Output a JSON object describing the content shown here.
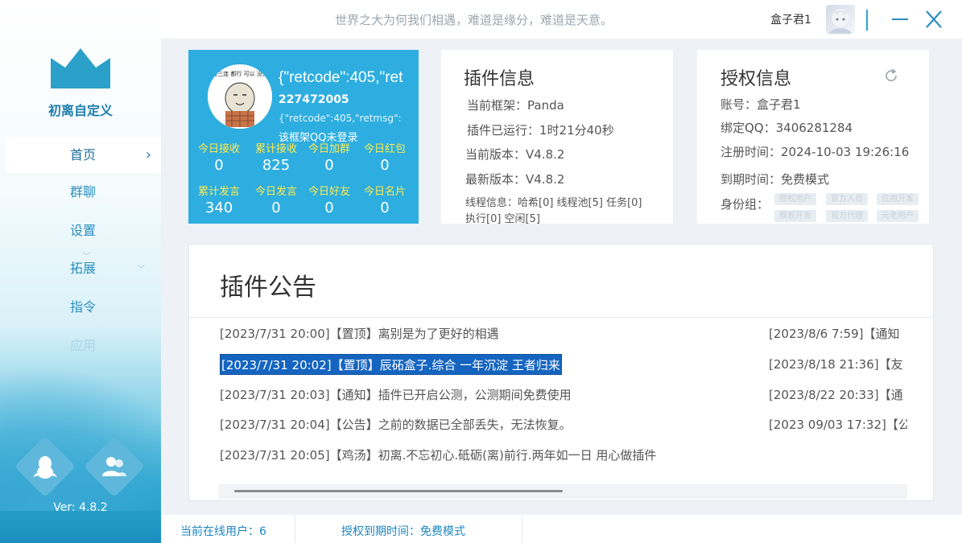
{
  "sidebar": {
    "brand": "初离自定义",
    "items": [
      {
        "label": "首页",
        "active": true
      },
      {
        "label": "群聊"
      },
      {
        "label": "设置"
      },
      {
        "label": "拓展"
      },
      {
        "label": "指令"
      },
      {
        "label": "应用"
      }
    ],
    "version": "Ver: 4.8.2",
    "icons": [
      "crown-logo",
      "qq-penguin-icon",
      "contacts-icon"
    ]
  },
  "header": {
    "motto": "世界之大为何我们相遇，难道是缘分，难道是天意。",
    "username": "盒子君1"
  },
  "bot_card": {
    "title": "{\"retcode\":405,\"ret",
    "qq": "227472005",
    "msg": "{\"retcode\":405,\"retmsg\":",
    "msg2": "该框架QQ未登录",
    "avatar_text": "渣男三连 都行 可以 没关系",
    "stats": [
      {
        "label": "今日接收",
        "value": "0"
      },
      {
        "label": "累计接收",
        "value": "825"
      },
      {
        "label": "今日加群",
        "value": "0"
      },
      {
        "label": "今日红包",
        "value": "0"
      },
      {
        "label": "累计发言",
        "value": "340"
      },
      {
        "label": "今日发言",
        "value": "0"
      },
      {
        "label": "今日好友",
        "value": "0"
      },
      {
        "label": "今日名片",
        "value": "0"
      }
    ]
  },
  "plugin_info": {
    "title": "插件信息",
    "framework": "当前框架：Panda",
    "runtime": "插件已运行：1时21分40秒",
    "current_version": "当前版本：V4.8.2",
    "latest_version": "最新版本：V4.8.2",
    "thread_info_1": "线程信息：哈希[0] 线程池[5] 任务[0]",
    "thread_info_2": "执行[0] 空闲[5]"
  },
  "auth_info": {
    "title": "授权信息",
    "account": "账号：盒子君1",
    "bound_qq": "绑定QQ：3406281284",
    "register_time": "注册时间：2024-10-03 19:26:16",
    "expire_time": "到期时间：免费模式",
    "identity_label": "身份组：",
    "groups": [
      "授权用户",
      "官方人员",
      "应用开发",
      "模板开发",
      "官方代理",
      "元老用户"
    ]
  },
  "announcement": {
    "title": "插件公告",
    "left_items": [
      "[2023/7/31 20:00]【置顶】离别是为了更好的相遇",
      "[2023/7/31 20:02]【置顶】辰砳盒子.综合 一年沉淀 王者归来",
      "[2023/7/31 20:03]【通知】插件已开启公测，公测期间免费使用",
      "[2023/7/31 20:04]【公告】之前的数据已全部丢失，无法恢复。",
      "[2023/7/31 20:05]【鸡汤】初离.不忘初心.砥砺(离)前行.两年如一日 用心做插件"
    ],
    "right_items": [
      "[2023/8/6 7:59]【通知",
      "[2023/8/18 21:36]【友",
      "[2023/8/22 20:33]【通",
      "[2023 09/03 17:32]【公"
    ],
    "selected_index": 1
  },
  "statusbar": {
    "online": "当前在线用户：6",
    "auth_expiry": "授权到期时间：免费模式"
  },
  "colors": {
    "accent": "#2eaee0",
    "stat_label": "#ffe94a",
    "selection": "#1565c0",
    "status_text": "#1d86c2"
  }
}
